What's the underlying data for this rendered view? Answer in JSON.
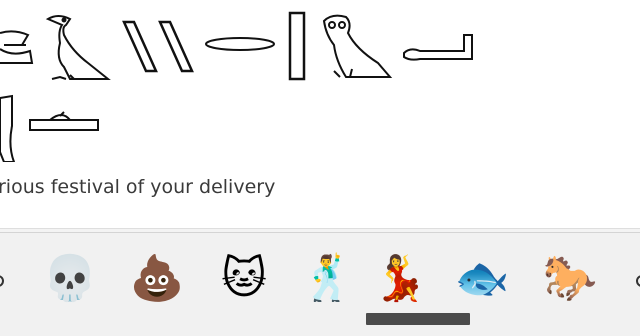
{
  "message": {
    "hieroglyph_line1": [
      "reed-and-water-glyph",
      "vulture-glyph",
      "double-stroke-glyph",
      "mouth-glyph",
      "single-stroke-glyph",
      "owl-glyph",
      "arm-glyph"
    ],
    "hieroglyph_line2": [
      "knife-glyph",
      "bread-loaf-glyph"
    ],
    "text": "rious festival of your delivery"
  },
  "emoji_bar": {
    "items": [
      {
        "name": "skull-emoji",
        "char": "💀"
      },
      {
        "name": "pile-of-poo-emoji",
        "char": "💩"
      },
      {
        "name": "cat-face-emoji",
        "char": "🐱"
      },
      {
        "name": "man-dancing-emoji",
        "char": "🕺"
      },
      {
        "name": "woman-dancing-emoji",
        "char": "💃"
      },
      {
        "name": "fish-emoji",
        "char": "🐟"
      },
      {
        "name": "horse-emoji",
        "char": "🐎"
      }
    ]
  },
  "colors": {
    "card": "#ffffff",
    "bar": "#f1f1f1",
    "text": "#3a3a3a",
    "scroll_thumb": "#4b4b4b"
  }
}
